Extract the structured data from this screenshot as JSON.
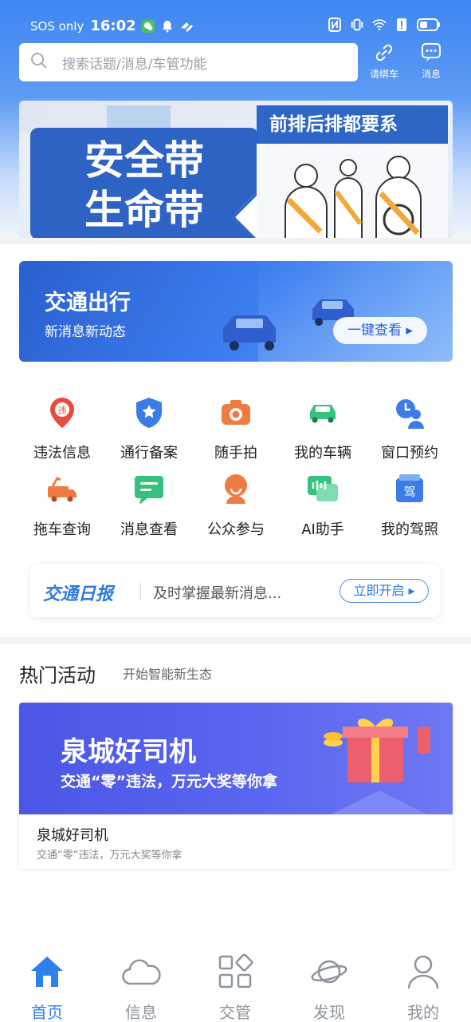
{
  "status_bar": {
    "carrier": "SOS only",
    "time": "16:02"
  },
  "search": {
    "placeholder": "搜索话题/消息/车管功能"
  },
  "header_buttons": {
    "bind_car": "请绑车",
    "messages": "消息"
  },
  "banner": {
    "left_line1": "安全带",
    "left_line2": "生命带",
    "right_title": "前排后排都要系"
  },
  "traffic_card": {
    "title": "交通出行",
    "subtitle": "新消息新动态",
    "button": "一键查看 ▸"
  },
  "services": [
    {
      "label": "违法信息",
      "icon": "violation-pin-icon",
      "color": "#e74c3c"
    },
    {
      "label": "通行备案",
      "icon": "shield-star-icon",
      "color": "#3b7ce6"
    },
    {
      "label": "随手拍",
      "icon": "camera-icon",
      "color": "#f07b42"
    },
    {
      "label": "我的车辆",
      "icon": "car-icon",
      "color": "#35c27e"
    },
    {
      "label": "窗口预约",
      "icon": "user-clock-icon",
      "color": "#3b7ce6"
    },
    {
      "label": "拖车查询",
      "icon": "tow-truck-icon",
      "color": "#f07b42"
    },
    {
      "label": "消息查看",
      "icon": "message-icon",
      "color": "#35c27e"
    },
    {
      "label": "公众参与",
      "icon": "person-icon",
      "color": "#f07b42"
    },
    {
      "label": "AI助手",
      "icon": "ai-chat-icon",
      "color": "#35c27e"
    },
    {
      "label": "我的驾照",
      "icon": "license-icon",
      "color": "#3b7ce6"
    }
  ],
  "daily": {
    "brand": "交通日报",
    "desc": "及时掌握最新消息...",
    "button": "立即开启 ▸"
  },
  "hot": {
    "title": "热门活动",
    "subtitle": "开始智能新生态"
  },
  "activity": {
    "image_title": "泉城好司机",
    "image_subtitle": "交通“零”违法，万元大奖等你拿",
    "name": "泉城好司机",
    "desc": "交通“零”违法，万元大奖等你拿"
  },
  "tabs": [
    {
      "label": "首页",
      "icon": "home-icon",
      "active": true
    },
    {
      "label": "信息",
      "icon": "cloud-icon",
      "active": false
    },
    {
      "label": "交管",
      "icon": "grid-icon",
      "active": false
    },
    {
      "label": "发现",
      "icon": "planet-icon",
      "active": false
    },
    {
      "label": "我的",
      "icon": "user-icon",
      "active": false
    }
  ],
  "colors": {
    "accent": "#2f80ed",
    "header_blue": "#3f86f2"
  }
}
